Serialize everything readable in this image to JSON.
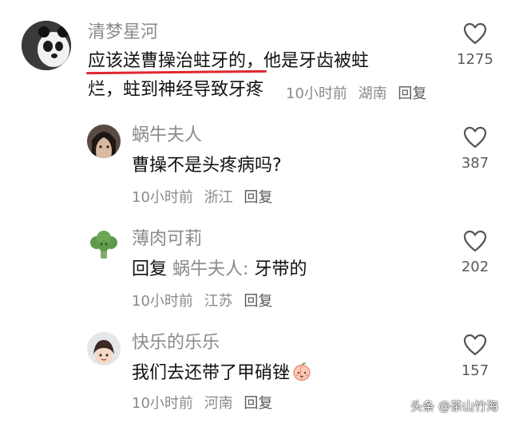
{
  "comments": [
    {
      "username": "清梦星河",
      "content_underlined": "应该送曹操治蛀牙的，",
      "content_rest_line1": "他是牙齿被蛀",
      "content_line2": "烂，蛀到神经导致牙疼",
      "time": "10小时前",
      "location": "湖南",
      "reply_label": "回复",
      "like_count": "1275",
      "avatar_icon": "panda-avatar"
    },
    {
      "username": "蜗牛夫人",
      "content": "曹操不是头疼病吗?",
      "time": "10小时前",
      "location": "浙江",
      "reply_label": "回复",
      "like_count": "387",
      "avatar_icon": "person-avatar"
    },
    {
      "username": "薄肉可莉",
      "reply_prefix": "回复",
      "reply_target": "蜗牛夫人:",
      "content": "牙带的",
      "time": "10小时前",
      "location": "江苏",
      "reply_label": "回复",
      "like_count": "202",
      "avatar_icon": "broccoli-avatar"
    },
    {
      "username": "快乐的乐乐",
      "content": "我们去还带了甲硝锉",
      "time": "10小时前",
      "location": "河南",
      "reply_label": "回复",
      "like_count": "157",
      "avatar_icon": "cartoon-avatar",
      "emoji_icon": "peach-emoji"
    }
  ],
  "watermark": "头条 @茶山竹海",
  "colors": {
    "underline": "#e0262e",
    "muted_text": "#8a8a8a",
    "main_text": "#111111"
  }
}
